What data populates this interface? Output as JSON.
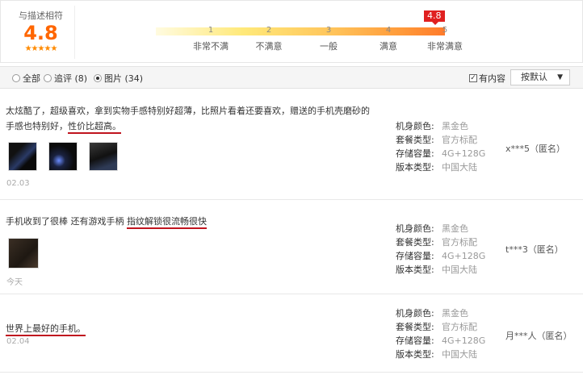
{
  "rating": {
    "label": "与描述相符",
    "score": "4.8",
    "stars": "★★★★★",
    "flag": "4.8",
    "ticks": [
      {
        "num": "1",
        "label": "非常不满"
      },
      {
        "num": "2",
        "label": "不满意"
      },
      {
        "num": "3",
        "label": "一般"
      },
      {
        "num": "4",
        "label": "满意"
      },
      {
        "num": "5",
        "label": "非常满意"
      }
    ]
  },
  "filters": {
    "all": "全部",
    "followup": "追评 (8)",
    "images": "图片 (34)",
    "has_content": "有内容",
    "sort": "按默认",
    "selected": "images"
  },
  "spec_keys": {
    "color": "机身颜色:",
    "package": "套餐类型:",
    "storage": "存储容量:",
    "version": "版本类型:"
  },
  "reviews": [
    {
      "text_line1": "太炫酷了，超级喜欢，拿到实物手感特别好超薄，比照片看着还要喜欢，赠送的手机壳磨砂的",
      "text_line2_plain": "手感也特别好，",
      "text_line2_hl": "性价比超高。",
      "date": "02.03",
      "color": "黑金色",
      "package": "官方标配",
      "storage": "4G+128G",
      "version": "中国大陆",
      "user": "x***5（匿名）"
    },
    {
      "text_plain": "手机收到了很棒 还有游戏手柄 ",
      "text_hl": "指纹解锁很流畅很快",
      "date": "今天",
      "color": "黑金色",
      "package": "官方标配",
      "storage": "4G+128G",
      "version": "中国大陆",
      "user": "t***3（匿名）"
    },
    {
      "text_hl": "世界上最好的手机。",
      "date": "02.04",
      "color": "黑金色",
      "package": "官方标配",
      "storage": "4G+128G",
      "version": "中国大陆",
      "user": "月***人（匿名）"
    }
  ]
}
